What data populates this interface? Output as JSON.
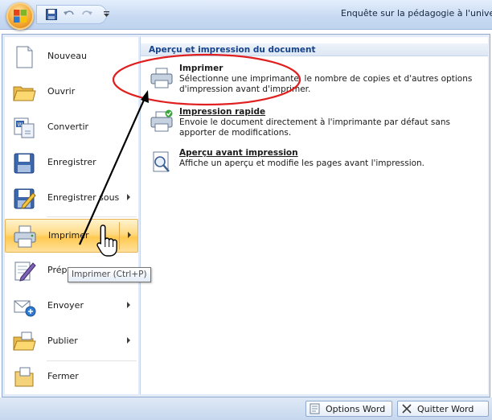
{
  "window": {
    "title": "Enquête sur la pédagogie à l'unive"
  },
  "office_button": {
    "icon": "office-logo-icon"
  },
  "quick_access": {
    "icons": [
      "save-icon",
      "undo-icon",
      "redo-icon",
      "customize-dropdown-icon"
    ]
  },
  "menu": {
    "items": [
      {
        "label": "Nouveau",
        "icon": "new-document-icon",
        "has_submenu": false
      },
      {
        "label": "Ouvrir",
        "icon": "open-folder-icon",
        "has_submenu": false
      },
      {
        "label": "Convertir",
        "icon": "convert-icon",
        "has_submenu": false
      },
      {
        "label": "Enregistrer",
        "icon": "save-icon",
        "has_submenu": false
      },
      {
        "label": "Enregistrer sous",
        "icon": "save-as-icon",
        "has_submenu": true
      },
      {
        "label": "Imprimer",
        "icon": "printer-icon",
        "has_submenu": true,
        "highlighted": true
      },
      {
        "label": "Prép",
        "icon": "prepare-icon",
        "has_submenu": true
      },
      {
        "label": "Envoyer",
        "icon": "send-icon",
        "has_submenu": true
      },
      {
        "label": "Publier",
        "icon": "publish-icon",
        "has_submenu": true
      },
      {
        "label": "Fermer",
        "icon": "close-folder-icon",
        "has_submenu": false
      }
    ]
  },
  "submenu": {
    "header": "Aperçu et impression du document",
    "items": [
      {
        "title": "Imprimer",
        "description": "Sélectionne une imprimante, le nombre de copies et d'autres options d'impression avant d'imprimer.",
        "icon": "printer-icon"
      },
      {
        "title": "Impression rapide",
        "description": "Envoie le document directement à l'imprimante par défaut sans apporter de modifications.",
        "icon": "quick-print-icon"
      },
      {
        "title": "Aperçu avant impression",
        "description": "Affiche un aperçu et modifie les pages avant l'impression.",
        "icon": "print-preview-icon"
      }
    ]
  },
  "tooltip": {
    "text": "Imprimer (Ctrl+P)"
  },
  "bottom": {
    "options_label": "Options Word",
    "quit_label": "Quitter Word"
  },
  "colors": {
    "highlight": "#ffd981",
    "header_text": "#15428b",
    "annotation": "#e02020"
  }
}
